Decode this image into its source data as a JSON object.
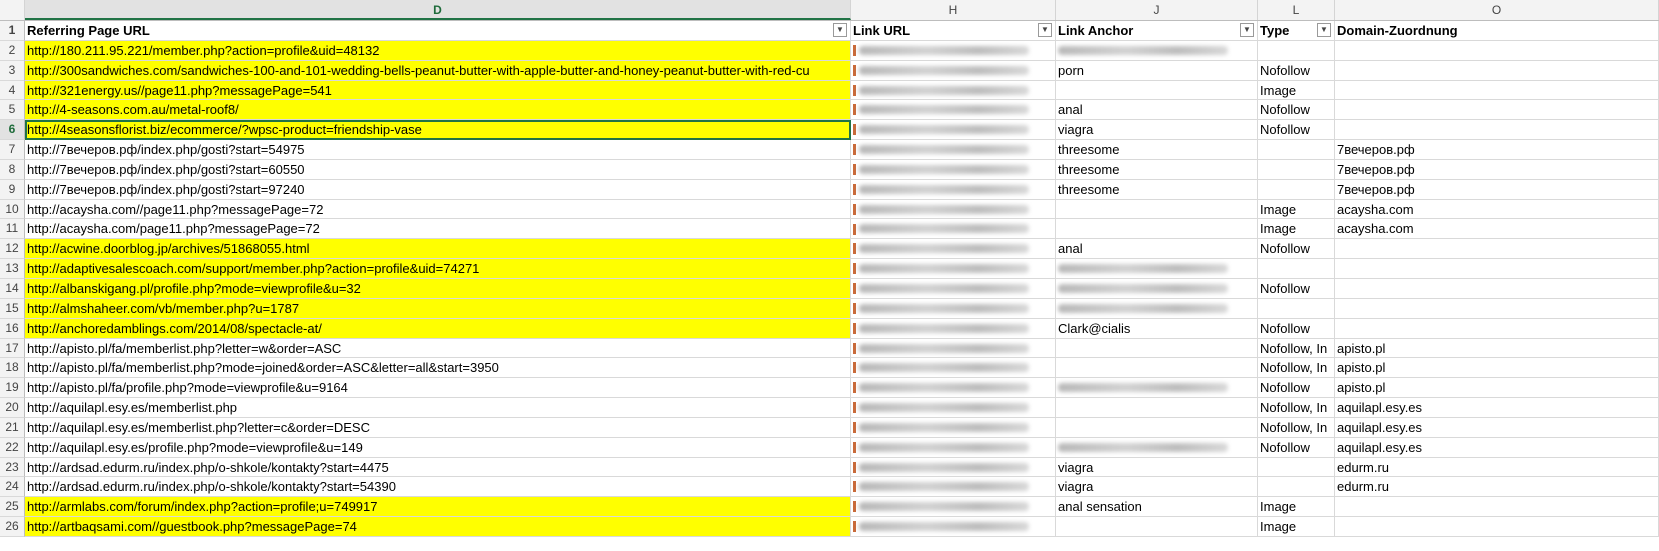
{
  "columns": [
    {
      "letter": "D",
      "active": true
    },
    {
      "letter": "H",
      "active": false
    },
    {
      "letter": "J",
      "active": false
    },
    {
      "letter": "L",
      "active": false
    },
    {
      "letter": "O",
      "active": false
    }
  ],
  "headers": {
    "row_number": "1",
    "D": "Referring Page URL",
    "H": "Link URL",
    "J": "Link Anchor",
    "L": "Type",
    "O": "Domain-Zuordnung"
  },
  "colors": {
    "highlight": "#ffff00",
    "selection": "#217346"
  },
  "filter_icon": "filter-dropdown-icon",
  "rows": [
    {
      "n": "2",
      "url": "http://180.211.95.221/member.php?action=profile&uid=48132",
      "anchor": "",
      "anchor_blurred": true,
      "type": "",
      "domain": "",
      "yellow": true
    },
    {
      "n": "3",
      "url": "http://300sandwiches.com/sandwiches-100-and-101-wedding-bells-peanut-butter-with-apple-butter-and-honey-peanut-butter-with-red-cu",
      "anchor": "porn",
      "anchor_blurred": false,
      "type": "Nofollow",
      "domain": "",
      "yellow": true
    },
    {
      "n": "4",
      "url": "http://321energy.us//page11.php?messagePage=541",
      "anchor": "",
      "anchor_blurred": false,
      "type": "Image",
      "domain": "",
      "yellow": true
    },
    {
      "n": "5",
      "url": "http://4-seasons.com.au/metal-roof8/",
      "anchor": "anal",
      "anchor_blurred": false,
      "type": "Nofollow",
      "domain": "",
      "yellow": true
    },
    {
      "n": "6",
      "url": "http://4seasonsflorist.biz/ecommerce/?wpsc-product=friendship-vase",
      "anchor": "viagra",
      "anchor_blurred": false,
      "type": "Nofollow",
      "domain": "",
      "yellow": true,
      "selected": true
    },
    {
      "n": "7",
      "url": "http://7вечеров.рф/index.php/gosti?start=54975",
      "anchor": "threesome",
      "anchor_blurred": false,
      "type": "",
      "domain": "7вечеров.рф",
      "yellow": false
    },
    {
      "n": "8",
      "url": "http://7вечеров.рф/index.php/gosti?start=60550",
      "anchor": "threesome",
      "anchor_blurred": false,
      "type": "",
      "domain": "7вечеров.рф",
      "yellow": false
    },
    {
      "n": "9",
      "url": "http://7вечеров.рф/index.php/gosti?start=97240",
      "anchor": "threesome",
      "anchor_blurred": false,
      "type": "",
      "domain": "7вечеров.рф",
      "yellow": false
    },
    {
      "n": "10",
      "url": "http://acaysha.com//page11.php?messagePage=72",
      "anchor": "",
      "anchor_blurred": false,
      "type": "Image",
      "domain": "acaysha.com",
      "yellow": false
    },
    {
      "n": "11",
      "url": "http://acaysha.com/page11.php?messagePage=72",
      "anchor": "",
      "anchor_blurred": false,
      "type": "Image",
      "domain": "acaysha.com",
      "yellow": false
    },
    {
      "n": "12",
      "url": "http://acwine.doorblog.jp/archives/51868055.html",
      "anchor": "anal",
      "anchor_blurred": false,
      "type": "Nofollow",
      "domain": "",
      "yellow": true
    },
    {
      "n": "13",
      "url": "http://adaptivesalescoach.com/support/member.php?action=profile&uid=74271",
      "anchor": "",
      "anchor_blurred": true,
      "type": "",
      "domain": "",
      "yellow": true
    },
    {
      "n": "14",
      "url": "http://albanskigang.pl/profile.php?mode=viewprofile&u=32",
      "anchor": "",
      "anchor_blurred": true,
      "type": "Nofollow",
      "domain": "",
      "yellow": true
    },
    {
      "n": "15",
      "url": "http://almshaheer.com/vb/member.php?u=1787",
      "anchor": "",
      "anchor_blurred": true,
      "type": "",
      "domain": "",
      "yellow": true
    },
    {
      "n": "16",
      "url": "http://anchoredamblings.com/2014/08/spectacle-at/",
      "anchor": "Clark@cialis",
      "anchor_blurred": false,
      "type": "Nofollow",
      "domain": "",
      "yellow": true
    },
    {
      "n": "17",
      "url": "http://apisto.pl/fa/memberlist.php?letter=w&order=ASC",
      "anchor": "",
      "anchor_blurred": false,
      "type": "Nofollow, In",
      "domain": "apisto.pl",
      "yellow": false
    },
    {
      "n": "18",
      "url": "http://apisto.pl/fa/memberlist.php?mode=joined&order=ASC&letter=all&start=3950",
      "anchor": "",
      "anchor_blurred": false,
      "type": "Nofollow, In",
      "domain": "apisto.pl",
      "yellow": false
    },
    {
      "n": "19",
      "url": "http://apisto.pl/fa/profile.php?mode=viewprofile&u=9164",
      "anchor": "",
      "anchor_blurred": true,
      "type": "Nofollow",
      "domain": "apisto.pl",
      "yellow": false
    },
    {
      "n": "20",
      "url": "http://aquilapl.esy.es/memberlist.php",
      "anchor": "",
      "anchor_blurred": false,
      "type": "Nofollow, In",
      "domain": "aquilapl.esy.es",
      "yellow": false
    },
    {
      "n": "21",
      "url": "http://aquilapl.esy.es/memberlist.php?letter=c&order=DESC",
      "anchor": "",
      "anchor_blurred": false,
      "type": "Nofollow, In",
      "domain": "aquilapl.esy.es",
      "yellow": false
    },
    {
      "n": "22",
      "url": "http://aquilapl.esy.es/profile.php?mode=viewprofile&u=149",
      "anchor": "",
      "anchor_blurred": true,
      "type": "Nofollow",
      "domain": "aquilapl.esy.es",
      "yellow": false
    },
    {
      "n": "23",
      "url": "http://ardsad.edurm.ru/index.php/o-shkole/kontakty?start=4475",
      "anchor": "viagra",
      "anchor_blurred": false,
      "type": "",
      "domain": "edurm.ru",
      "yellow": false
    },
    {
      "n": "24",
      "url": "http://ardsad.edurm.ru/index.php/o-shkole/kontakty?start=54390",
      "anchor": "viagra",
      "anchor_blurred": false,
      "type": "",
      "domain": "edurm.ru",
      "yellow": false
    },
    {
      "n": "25",
      "url": "http://armlabs.com/forum/index.php?action=profile;u=749917",
      "anchor": "anal sensation",
      "anchor_blurred": false,
      "type": "Image",
      "domain": "",
      "yellow": true
    },
    {
      "n": "26",
      "url": "http://artbaqsami.com//guestbook.php?messagePage=74",
      "anchor": "",
      "anchor_blurred": false,
      "type": "Image",
      "domain": "",
      "yellow": true
    }
  ]
}
